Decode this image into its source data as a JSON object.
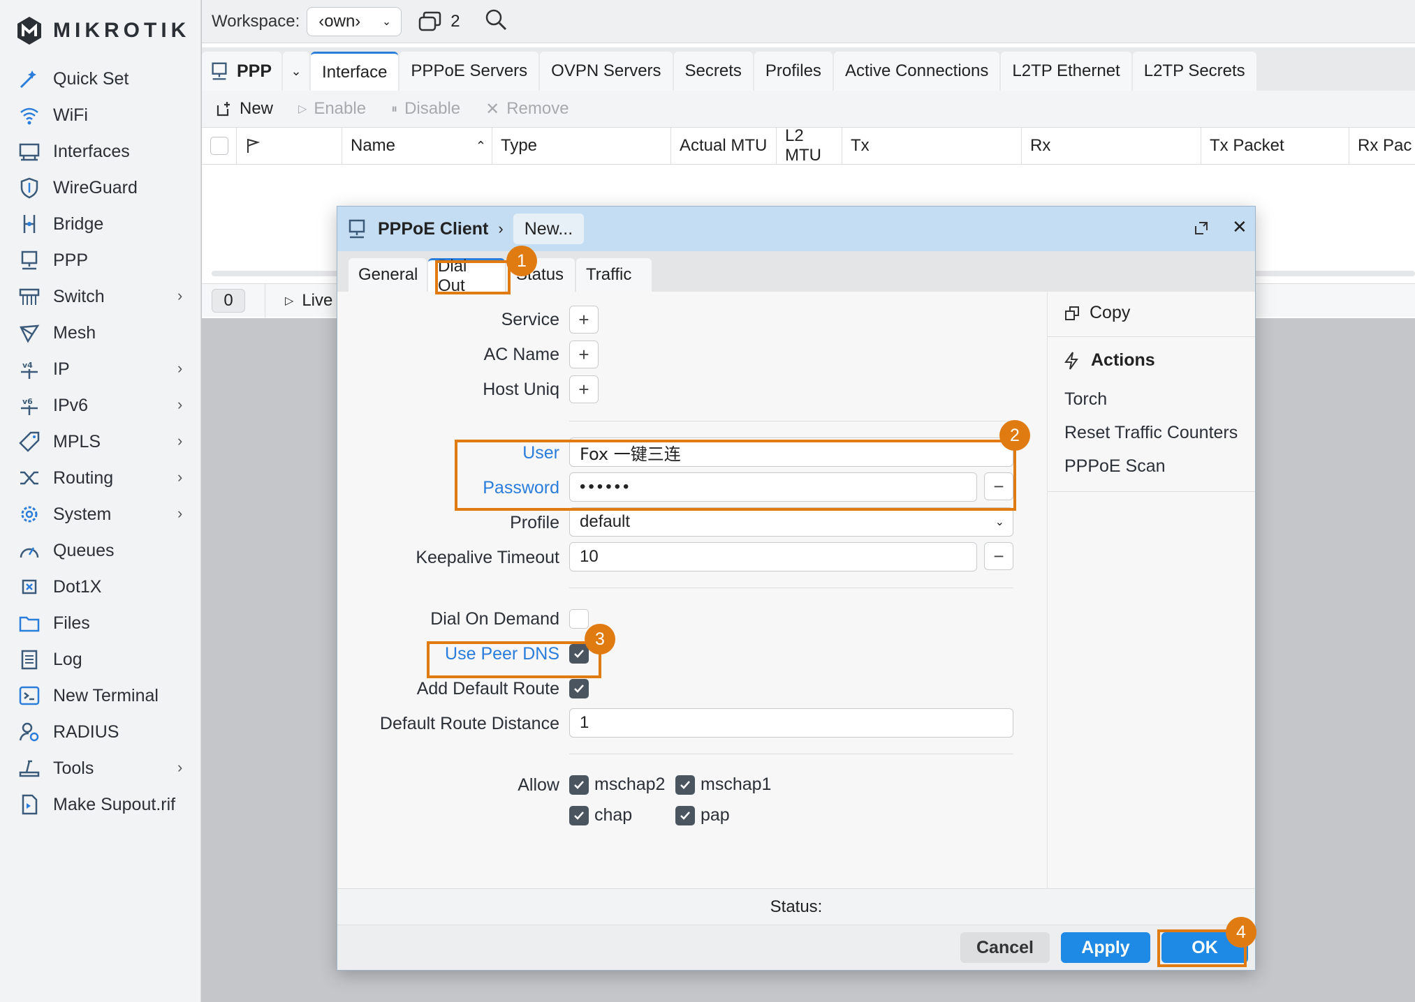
{
  "colors": {
    "accent": "#2a7ddb",
    "annotation": "#e07b12",
    "title_bar": "#c5ddf2",
    "button_primary": "#1f8ae6"
  },
  "sidebar": {
    "brand": "MIKROTIK",
    "items": [
      {
        "label": "Quick Set",
        "icon": "quick-set-icon",
        "has_submenu": false
      },
      {
        "label": "WiFi",
        "icon": "wifi-icon",
        "has_submenu": false
      },
      {
        "label": "Interfaces",
        "icon": "interfaces-icon",
        "has_submenu": false
      },
      {
        "label": "WireGuard",
        "icon": "wireguard-icon",
        "has_submenu": false
      },
      {
        "label": "Bridge",
        "icon": "bridge-icon",
        "has_submenu": false
      },
      {
        "label": "PPP",
        "icon": "ppp-icon",
        "has_submenu": false
      },
      {
        "label": "Switch",
        "icon": "switch-icon",
        "has_submenu": true
      },
      {
        "label": "Mesh",
        "icon": "mesh-icon",
        "has_submenu": false
      },
      {
        "label": "IP",
        "icon": "ip-icon",
        "has_submenu": true
      },
      {
        "label": "IPv6",
        "icon": "ipv6-icon",
        "has_submenu": true
      },
      {
        "label": "MPLS",
        "icon": "mpls-icon",
        "has_submenu": true
      },
      {
        "label": "Routing",
        "icon": "routing-icon",
        "has_submenu": true
      },
      {
        "label": "System",
        "icon": "system-icon",
        "has_submenu": true
      },
      {
        "label": "Queues",
        "icon": "queues-icon",
        "has_submenu": false
      },
      {
        "label": "Dot1X",
        "icon": "dot1x-icon",
        "has_submenu": false
      },
      {
        "label": "Files",
        "icon": "files-icon",
        "has_submenu": false
      },
      {
        "label": "Log",
        "icon": "log-icon",
        "has_submenu": false
      },
      {
        "label": "New Terminal",
        "icon": "terminal-icon",
        "has_submenu": false
      },
      {
        "label": "RADIUS",
        "icon": "radius-icon",
        "has_submenu": false
      },
      {
        "label": "Tools",
        "icon": "tools-icon",
        "has_submenu": true
      },
      {
        "label": "Make Supout.rif",
        "icon": "supout-icon",
        "has_submenu": false
      }
    ]
  },
  "topbar": {
    "workspace_label": "Workspace:",
    "workspace_value": "‹own›",
    "windows_count": "2"
  },
  "ppp": {
    "title": "PPP",
    "tabs": [
      "Interface",
      "PPPoE Servers",
      "OVPN Servers",
      "Secrets",
      "Profiles",
      "Active Connections",
      "L2TP Ethernet",
      "L2TP Secrets"
    ],
    "active_tab": "Interface",
    "toolbar": {
      "new": "New",
      "enable": "Enable",
      "disable": "Disable",
      "remove": "Remove"
    },
    "columns": [
      "Name",
      "Type",
      "Actual MTU",
      "L2 MTU",
      "Tx",
      "Rx",
      "Tx Packet",
      "Rx Pac"
    ],
    "count": "0",
    "live": "Live"
  },
  "dialog": {
    "title": "PPPoE Client",
    "crumb": "New...",
    "tabs": [
      "General",
      "Dial Out",
      "Status",
      "Traffic"
    ],
    "active_tab": "Dial Out",
    "fields": {
      "service": "Service",
      "ac_name": "AC Name",
      "host_uniq": "Host Uniq",
      "user_label": "User",
      "user_value": "Fox 一键三连",
      "password_label": "Password",
      "password_value": "••••••",
      "profile_label": "Profile",
      "profile_value": "default",
      "keepalive_label": "Keepalive Timeout",
      "keepalive_value": "10",
      "dial_on_demand": "Dial On Demand",
      "use_peer_dns": "Use Peer DNS",
      "add_default_route": "Add Default Route",
      "route_distance_label": "Default Route Distance",
      "route_distance_value": "1",
      "allow_label": "Allow",
      "allow_options": [
        "mschap2",
        "mschap1",
        "chap",
        "pap"
      ]
    },
    "checks": {
      "dial_on_demand": false,
      "use_peer_dns": true,
      "add_default_route": true,
      "mschap2": true,
      "mschap1": true,
      "chap": true,
      "pap": true
    },
    "side": {
      "copy": "Copy",
      "actions": "Actions",
      "items": [
        "Torch",
        "Reset Traffic Counters",
        "PPPoE Scan"
      ]
    },
    "status": "Status:",
    "buttons": {
      "cancel": "Cancel",
      "apply": "Apply",
      "ok": "OK"
    }
  },
  "annotations": [
    "1",
    "2",
    "3",
    "4"
  ]
}
